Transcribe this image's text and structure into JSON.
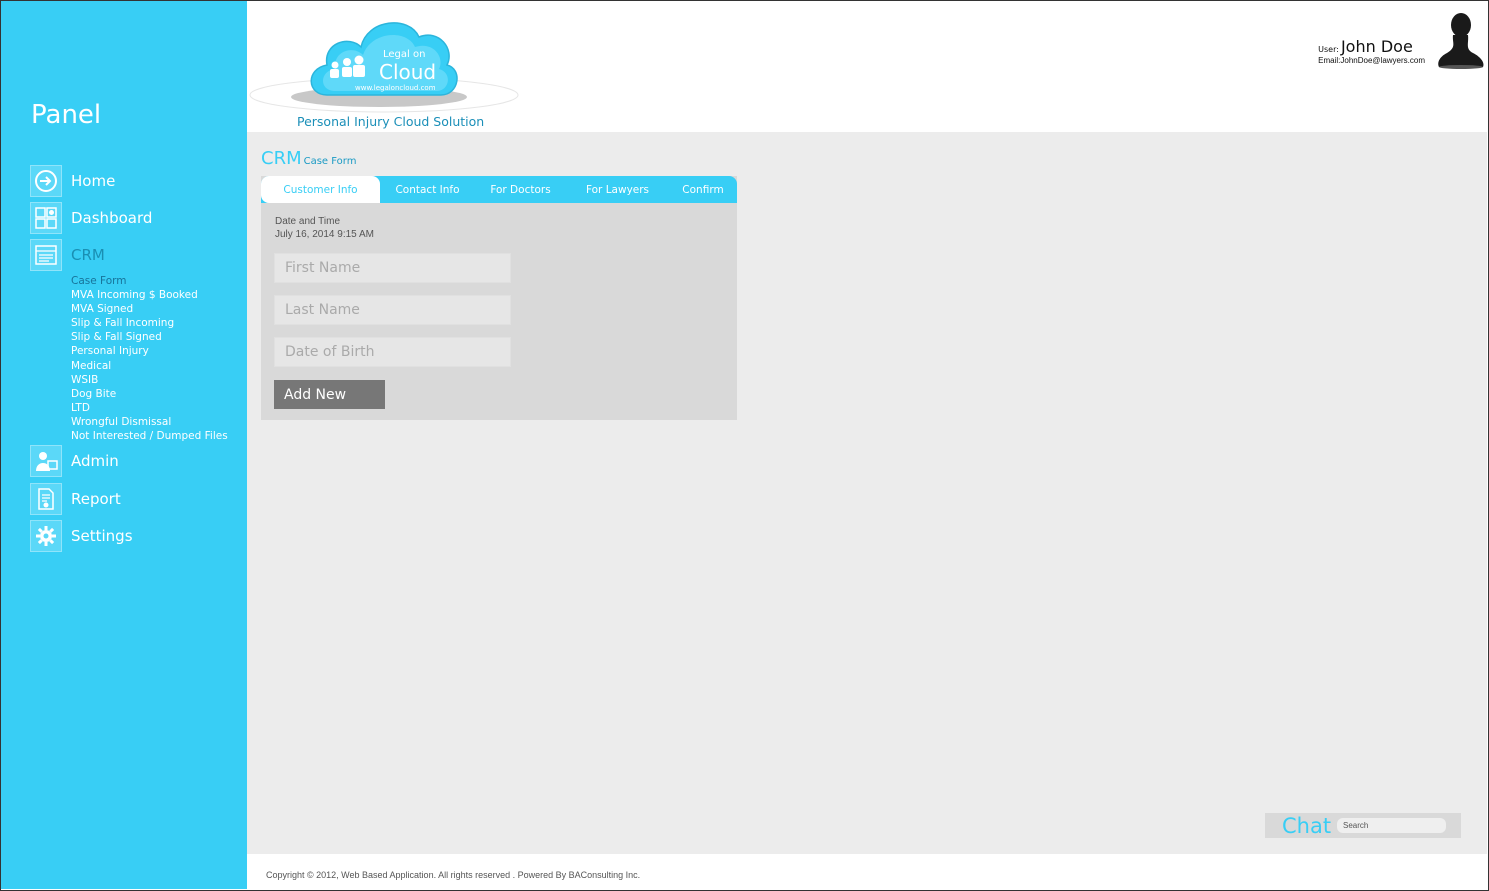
{
  "sidebar": {
    "title": "Panel",
    "items": [
      {
        "label": "Home",
        "icon": "arrow-right-icon"
      },
      {
        "label": "Dashboard",
        "icon": "dashboard-icon"
      },
      {
        "label": "CRM",
        "icon": "crm-icon"
      },
      {
        "label": "Admin",
        "icon": "admin-icon"
      },
      {
        "label": "Report",
        "icon": "report-icon"
      },
      {
        "label": "Settings",
        "icon": "gear-icon"
      }
    ],
    "crm_subitems": [
      "Case Form",
      "MVA Incoming $ Booked",
      "MVA Signed",
      "Slip & Fall Incoming",
      "Slip & Fall Signed",
      "Personal Injury",
      "Medical",
      "WSIB",
      "Dog Bite",
      "LTD",
      "Wrongful Dismissal",
      "Not Interested / Dumped Files"
    ]
  },
  "header": {
    "logo_top": "Legal on",
    "logo_main": "Cloud",
    "logo_url": "www.legaloncloud.com",
    "tagline": "Personal Injury Cloud Solution",
    "user_label": "User:",
    "user_name": "John Doe",
    "email_label": "Email:",
    "email": "JohnDoe@lawyers.com"
  },
  "main": {
    "title": "CRM",
    "subtitle": "Case Form",
    "tabs": [
      "Customer Info",
      "Contact Info",
      "For Doctors",
      "For Lawyers",
      "Confirm"
    ],
    "date_label": "Date and Time",
    "date_value": "July 16, 2014  9:15 AM",
    "fields": {
      "first_name": "First Name",
      "last_name": "Last Name",
      "dob": "Date of Birth"
    },
    "add_button": "Add New"
  },
  "chat": {
    "label": "Chat",
    "search_placeholder": "Search"
  },
  "footer": {
    "copyright": "Copyright © 2012, Web Based Application. All rights reserved . Powered By BAConsulting Inc."
  },
  "colors": {
    "accent": "#38cef5",
    "accent_dark": "#1a8fb3",
    "form_bg": "#d9d9d9",
    "button_bg": "#777777"
  }
}
